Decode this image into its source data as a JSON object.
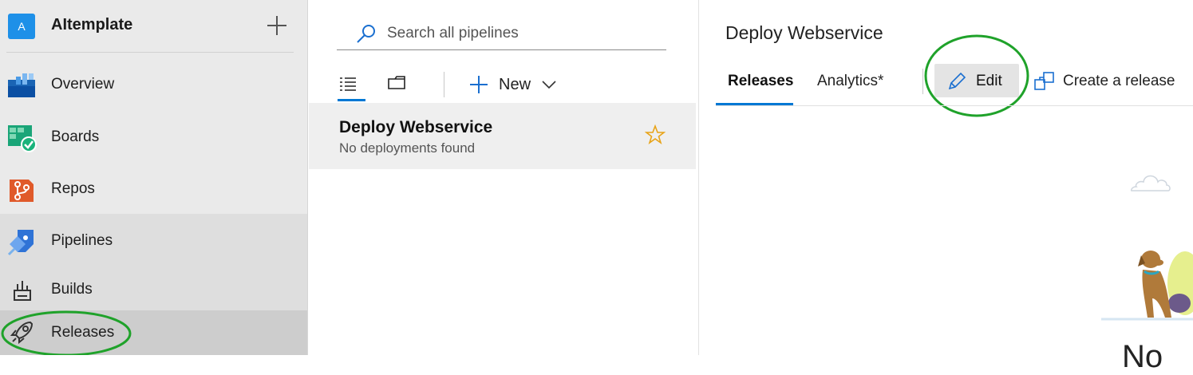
{
  "sidebar": {
    "org": {
      "initial": "A",
      "name": "AItemplate"
    },
    "add_icon": "plus-icon",
    "items": [
      {
        "key": "overview",
        "label": "Overview",
        "icon": "overview-icon"
      },
      {
        "key": "boards",
        "label": "Boards",
        "icon": "boards-icon"
      },
      {
        "key": "repos",
        "label": "Repos",
        "icon": "repos-icon"
      },
      {
        "key": "pipelines",
        "label": "Pipelines",
        "icon": "pipelines-icon",
        "active_section": true
      },
      {
        "key": "builds",
        "label": "Builds",
        "icon": "builds-icon"
      },
      {
        "key": "releases",
        "label": "Releases",
        "icon": "rocket-icon",
        "selected": true
      }
    ]
  },
  "list_panel": {
    "search": {
      "placeholder": "Search all pipelines",
      "icon": "search-icon"
    },
    "toolbar": {
      "list_view_icon": "list-view-icon",
      "folder_view_icon": "folder-icon",
      "new_label": "New",
      "new_icon": "plus-icon",
      "new_chevron": "chevron-down-icon"
    },
    "pipelines": [
      {
        "name": "Deploy Webservice",
        "status": "No deployments found",
        "favorite_icon": "star-icon"
      }
    ]
  },
  "detail": {
    "title": "Deploy Webservice",
    "tabs": [
      {
        "label": "Releases",
        "selected": true
      },
      {
        "label": "Analytics*"
      }
    ],
    "edit_button": {
      "label": "Edit",
      "icon": "pencil-icon"
    },
    "create_release": {
      "label": "Create a release",
      "icon": "create-release-icon"
    },
    "partial_heading": "No"
  },
  "annotations": {
    "highlight_color": "#1fa22a"
  },
  "colors": {
    "accent": "#0078d4",
    "star": "#e8a317",
    "sidebar_bg": "#eaeaea"
  }
}
